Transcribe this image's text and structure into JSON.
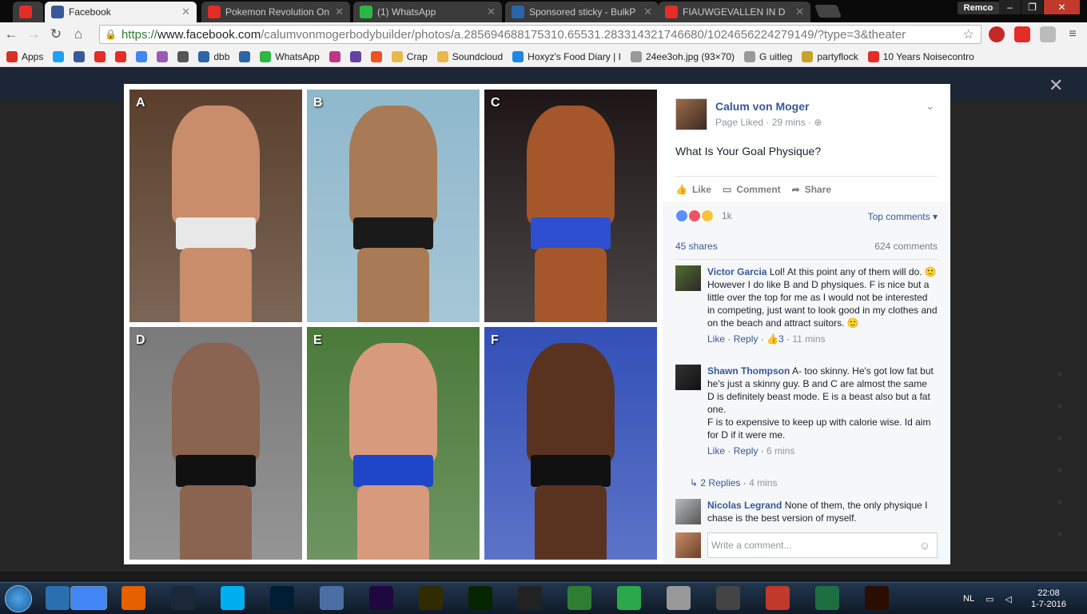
{
  "browser": {
    "tabs": [
      {
        "title": "",
        "icon": "youtube-icon",
        "color": "#e52d27"
      },
      {
        "title": "Facebook",
        "icon": "facebook-icon",
        "color": "#3b5998"
      },
      {
        "title": "Pokemon Revolution Onl",
        "icon": "youtube-icon",
        "color": "#e52d27"
      },
      {
        "title": "(1) WhatsApp",
        "icon": "whatsapp-icon",
        "color": "#2cb742"
      },
      {
        "title": "Sponsored sticky - BulkP",
        "icon": "forum-icon",
        "color": "#2b65a8"
      },
      {
        "title": "FIAUWGEVALLEN IN D",
        "icon": "youtube-icon",
        "color": "#e52d27"
      }
    ],
    "user": "Remco",
    "url_secure": "https://",
    "url_domain": "www.facebook.com",
    "url_path": "/calumvonmogerbodybuilder/photos/a.285694688175310.65531.283314321746680/1024656224279149/?type=3&theater",
    "bookmarks": [
      {
        "label": "Apps",
        "icon": "apps-icon",
        "color": "#d93025"
      },
      {
        "label": "",
        "icon": "twitter-icon",
        "color": "#1da1f2"
      },
      {
        "label": "",
        "icon": "facebook-icon",
        "color": "#3b5998"
      },
      {
        "label": "",
        "icon": "youtube-icon",
        "color": "#e52d27"
      },
      {
        "label": "",
        "icon": "d-icon",
        "color": "#e52d27"
      },
      {
        "label": "",
        "icon": "google-icon",
        "color": "#4285f4"
      },
      {
        "label": "",
        "icon": "w-icon",
        "color": "#9b59b6"
      },
      {
        "label": "",
        "icon": "dollar-icon",
        "color": "#555555"
      },
      {
        "label": "dbb",
        "icon": "puzzle-icon",
        "color": "#2b65a8"
      },
      {
        "label": "",
        "icon": "puzzle-icon",
        "color": "#2b65a8"
      },
      {
        "label": "WhatsApp",
        "icon": "whatsapp-icon",
        "color": "#2cb742"
      },
      {
        "label": "",
        "icon": "instagram-icon",
        "color": "#c13584"
      },
      {
        "label": "",
        "icon": "twitch-icon",
        "color": "#6441a5"
      },
      {
        "label": "",
        "icon": "windows-icon",
        "color": "#f25022"
      },
      {
        "label": "Crap",
        "icon": "folder-icon",
        "color": "#e8b84a"
      },
      {
        "label": "Soundcloud",
        "icon": "folder-icon",
        "color": "#e8b84a"
      },
      {
        "label": "Hoxyz's Food Diary | I",
        "icon": "x-icon",
        "color": "#1e88e5"
      },
      {
        "label": "24ee3oh.jpg (93×70)",
        "icon": "page-icon",
        "color": "#999999"
      },
      {
        "label": "G uitleg",
        "icon": "page-icon",
        "color": "#999999"
      },
      {
        "label": "partyflock",
        "icon": "partyflock-icon",
        "color": "#c9a227"
      },
      {
        "label": "10 Years Noisecontro",
        "icon": "youtube-icon",
        "color": "#e52d27"
      }
    ]
  },
  "photo": {
    "panels": [
      {
        "label": "A",
        "bg": "#5a3f2c",
        "skin": "#c98d6b",
        "shorts": "#e8e8e8"
      },
      {
        "label": "B",
        "bg": "#8fb8cc",
        "skin": "#a87a55",
        "shorts": "#1a1a1a"
      },
      {
        "label": "C",
        "bg": "#1e1616",
        "skin": "#a5562a",
        "shorts": "#2d4fd0"
      },
      {
        "label": "D",
        "bg": "#7a7a7a",
        "skin": "#8a6450",
        "shorts": "#111111"
      },
      {
        "label": "E",
        "bg": "#4a7a3a",
        "skin": "#d89a7c",
        "shorts": "#1f46c9"
      },
      {
        "label": "F",
        "bg": "#3350b8",
        "skin": "#5a3320",
        "shorts": "#111111"
      }
    ]
  },
  "post": {
    "author": "Calum von Moger",
    "meta": "Page Liked · 29 mins · ",
    "text": "What Is Your Goal Physique?",
    "actions": {
      "like": "Like",
      "comment": "Comment",
      "share": "Share"
    },
    "reaction_count": "1k",
    "top_comments": "Top comments ▾",
    "shares": "45 shares",
    "comments_count": "624 comments",
    "comments": [
      {
        "name": "Victor Garcia",
        "text": "Lol! At this point any of them will do. 🙂 However I do like B and D physiques. F is nice but a little over the top for me as I would not be interested in competing, just want to look good in my clothes and on the beach and attract suitors. 🙂",
        "like": "Like",
        "reply": "Reply",
        "likes": "3",
        "time": "11 mins"
      },
      {
        "name": "Shawn Thompson",
        "text": "A- too skinny. He's got low fat but he's just a skinny guy. B and C are almost the same\nD is definitely beast mode. E is a beast also but a fat one.\nF is to expensive to keep up with calorie wise. Id aim for D if it were me.",
        "like": "Like",
        "reply": "Reply",
        "time": "6 mins"
      },
      {
        "name": "Nicolas Legrand",
        "text": "None of them, the only physique I chase is the best version of myself."
      }
    ],
    "replies": "2 Replies",
    "replies_time": "4 mins",
    "write_placeholder": "Write a comment..."
  },
  "taskbar": {
    "apps": [
      {
        "icon": "ie-icon",
        "color": "#2a6fb0"
      },
      {
        "icon": "chrome-icon",
        "color": "#4285f4"
      },
      {
        "icon": "firefox-icon",
        "color": "#e66000"
      },
      {
        "icon": "steam-icon",
        "color": "#1b2838"
      },
      {
        "icon": "skype-icon",
        "color": "#00aff0"
      },
      {
        "icon": "photoshop-icon",
        "color": "#001d34"
      },
      {
        "icon": "keyboard-icon",
        "color": "#4a6fa5"
      },
      {
        "icon": "after-effects-icon",
        "color": "#1f0740"
      },
      {
        "icon": "muse-icon",
        "color": "#332b00"
      },
      {
        "icon": "dreamweaver-icon",
        "color": "#072401"
      },
      {
        "icon": "video-icon",
        "color": "#222222"
      },
      {
        "icon": "game-icon",
        "color": "#2e7d32"
      },
      {
        "icon": "h-icon",
        "color": "#2aa84a"
      },
      {
        "icon": "monitor-icon",
        "color": "#999999"
      },
      {
        "icon": "disc-icon",
        "color": "#444444"
      },
      {
        "icon": "creature-icon",
        "color": "#c0392b"
      },
      {
        "icon": "excel-icon",
        "color": "#1d6f42"
      },
      {
        "icon": "illustrator-icon",
        "color": "#2b0e00"
      }
    ],
    "lang": "NL",
    "time": "22:08",
    "date": "1-7-2016"
  }
}
